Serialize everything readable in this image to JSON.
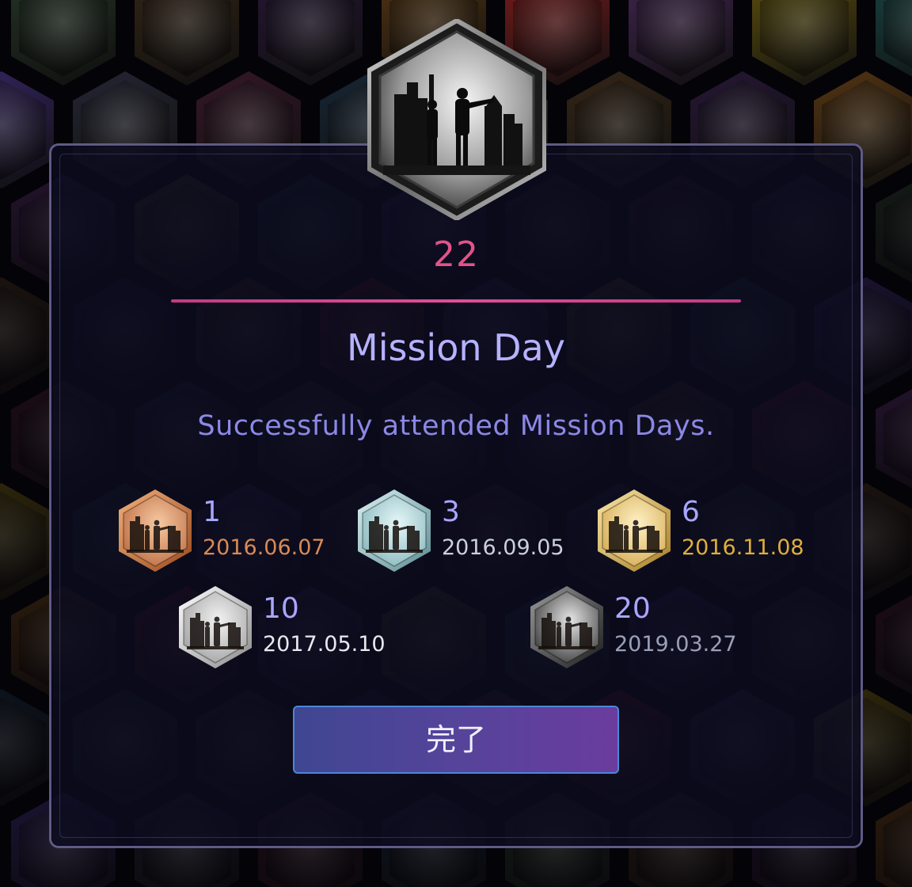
{
  "badge": {
    "title": "Mission Day",
    "count": "22",
    "description": "Successfully attended Mission Days.",
    "icon": "mission-day-badge-icon"
  },
  "tiers": [
    {
      "count": "1",
      "date": "2016.06.07",
      "level": "bronze",
      "date_color": "#d88a55"
    },
    {
      "count": "3",
      "date": "2016.09.05",
      "level": "silver",
      "date_color": "#c9cfe0"
    },
    {
      "count": "6",
      "date": "2016.11.08",
      "level": "gold",
      "date_color": "#e0ae3a"
    },
    {
      "count": "10",
      "date": "2017.05.10",
      "level": "platinum",
      "date_color": "#e8e8f0"
    },
    {
      "count": "20",
      "date": "2019.03.27",
      "level": "onyx",
      "date_color": "#9aa0b8"
    }
  ],
  "done_button": {
    "label": "完了"
  },
  "colors": {
    "accent_pink": "#e2538a",
    "title_purple": "#b6b2ff",
    "desc_purple": "#8c88e6",
    "modal_border": "#5f5a86"
  }
}
